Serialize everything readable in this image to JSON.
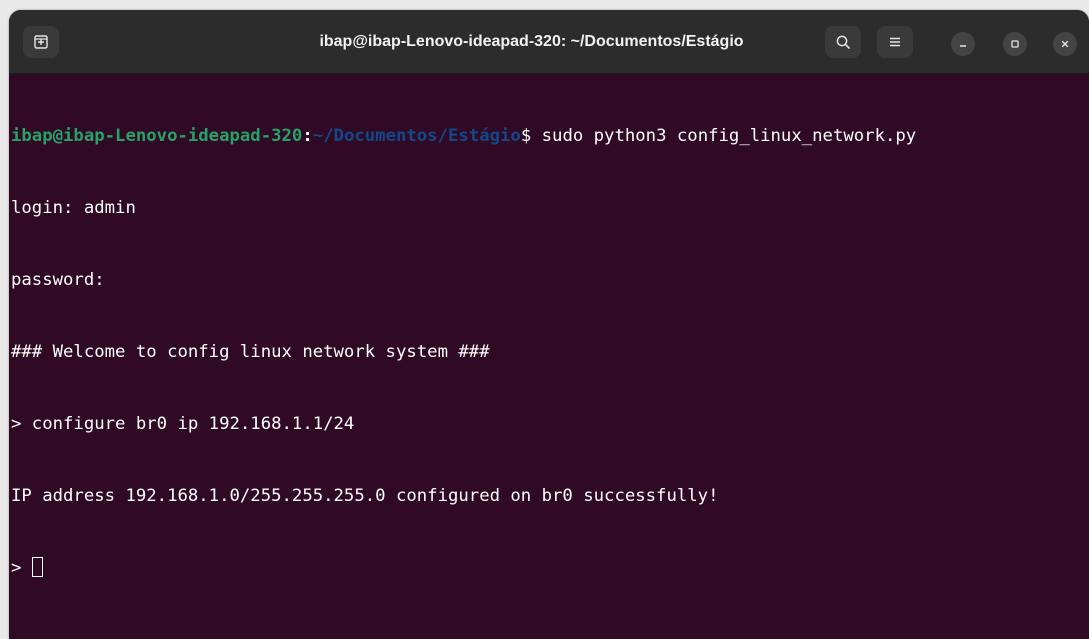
{
  "window": {
    "title": "ibap@ibap-Lenovo-ideapad-320: ~/Documentos/Estágio",
    "icons": {
      "new_tab": "new-tab-icon",
      "search": "search-icon",
      "menu": "hamburger-menu-icon",
      "minimize": "minimize-icon",
      "maximize": "maximize-icon",
      "close": "close-icon"
    }
  },
  "colors": {
    "terminal_bg": "#300a24",
    "titlebar_bg": "#2c2c2c",
    "prompt_user": "#26a269",
    "prompt_path": "#12488b",
    "text": "#ffffff"
  },
  "terminal": {
    "prompt_user": "ibap@ibap-Lenovo-ideapad-320",
    "prompt_colon": ":",
    "prompt_path": "~/Documentos/Estágio",
    "prompt_command": "$ sudo python3 config_linux_network.py",
    "lines": [
      "login: admin",
      "password:",
      "### Welcome to config linux network system ###",
      "> configure br0 ip 192.168.1.1/24",
      "IP address 192.168.1.0/255.255.255.0 configured on br0 successfully!"
    ],
    "input_prompt": "> "
  }
}
